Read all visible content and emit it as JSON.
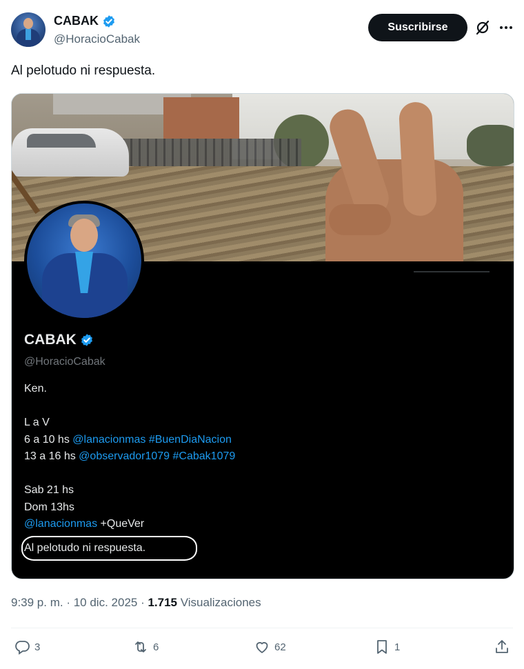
{
  "author": {
    "display_name": "CABAK",
    "handle": "@HoracioCabak",
    "verified": true,
    "avatar": "avatar-suit-blue"
  },
  "header": {
    "subscribe_label": "Suscribirse",
    "grok_icon": "grok-icon",
    "more_icon": "more-icon"
  },
  "tweet": {
    "text": "Al pelotudo ni respuesta."
  },
  "profile_card": {
    "display_name": "CABAK",
    "handle": "@HoracioCabak",
    "bio": {
      "line1": "Ken.",
      "line2": "L a V",
      "line3_prefix": "6 a 10 hs ",
      "line3_mention": "@lanacionmas",
      "line3_hashtag": "#BuenDiaNacion",
      "line4_prefix": "13 a 16 hs ",
      "line4_mention": "@observador1079",
      "line4_hashtag": "#Cabak1079",
      "line5": "Sab 21 hs",
      "line6": "Dom 13hs",
      "line7_mention": "@lanacionmas",
      "line7_suffix": " +QueVer",
      "line8": "Al pelotudo ni respuesta."
    }
  },
  "meta": {
    "time": "9:39 p. m.",
    "sep1": " · ",
    "date": "10 dic. 2025",
    "sep2": " · ",
    "views_count": "1.715",
    "views_label": "Visualizaciones"
  },
  "actions": {
    "replies": "3",
    "reposts": "6",
    "likes": "62",
    "bookmarks": "1"
  },
  "colors": {
    "link": "#1d9bf0",
    "verified": "#1d9bf0",
    "text_primary": "#0f1419",
    "text_secondary": "#536471",
    "card_bg": "#000000"
  }
}
